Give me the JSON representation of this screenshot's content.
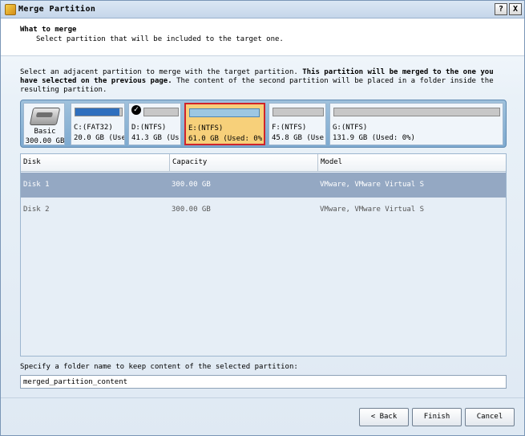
{
  "window": {
    "title": "Merge Partition",
    "help_label": "?",
    "close_label": "X"
  },
  "header": {
    "title": "What to merge",
    "subtitle": "Select partition that will be included to the target one."
  },
  "description": {
    "part1": "Select an adjacent partition to merge with the target partition. ",
    "bold": "This partition will be merged to the one you have selected on the previous page.",
    "part2": " The content of the second partition will be placed in a folder inside the resulting partition."
  },
  "disk_tile": {
    "icon": "hard-disk-icon",
    "type": "Basic",
    "size": "300.00 GB"
  },
  "partitions": [
    {
      "name": "C:(FAT32)",
      "info": "20.0 GB (Use",
      "used_fraction": 0.95,
      "checked": false,
      "selected": false
    },
    {
      "name": "D:(NTFS)",
      "info": "41.3 GB (Us",
      "used_fraction": 0.0,
      "checked": true,
      "selected": false
    },
    {
      "name": "E:(NTFS)",
      "info": "61.0 GB (Used: 0%",
      "used_fraction": 0.0,
      "checked": false,
      "selected": true
    },
    {
      "name": "F:(NTFS)",
      "info": "45.8 GB (Use",
      "used_fraction": 0.0,
      "checked": false,
      "selected": false
    },
    {
      "name": "G:(NTFS)",
      "info": "131.9 GB (Used: 0%)",
      "used_fraction": 0.0,
      "checked": false,
      "selected": false
    }
  ],
  "table": {
    "columns": [
      "Disk",
      "Capacity",
      "Model"
    ],
    "rows": [
      {
        "disk": "Disk 1",
        "capacity": "300.00 GB",
        "model": "VMware, VMware Virtual S",
        "selected": true
      },
      {
        "disk": "Disk 2",
        "capacity": "300.00 GB",
        "model": "VMware, VMware Virtual S",
        "selected": false
      }
    ]
  },
  "folder": {
    "label": "Specify a folder name to keep content of the selected partition:",
    "value": "merged_partition_content"
  },
  "buttons": {
    "back": "< Back",
    "finish": "Finish",
    "cancel": "Cancel"
  },
  "colors": {
    "selected_partition_bg": "#f7d07a",
    "selected_partition_border": "#d0242a",
    "selected_row_bg": "#94a8c3",
    "used_bar": "#2f6fbe"
  }
}
